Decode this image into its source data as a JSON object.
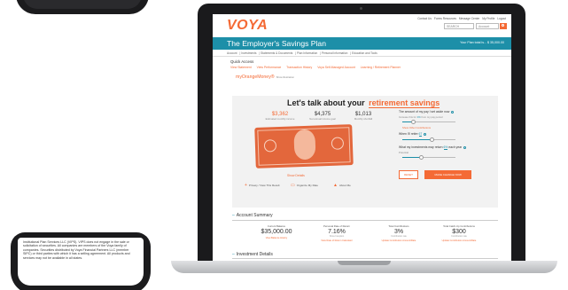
{
  "phone": {
    "text": "Institutional Plan Services LLC (VIPS). VIPS does not engage in the sale or solicitation of securities. All companies are members of the Voya family of companies. Securities distributed by Voya Financial Partners LLC (member SIPC) or third parties with which it has a selling agreement. All products and services may not be available in all states."
  },
  "brand": {
    "logo": "VOYA",
    "accent": "#f46a35",
    "teal": "#1d8fa8"
  },
  "top_links": [
    "Contact Us",
    "Forms Resources",
    "Message Center",
    "My Profile",
    "Logout"
  ],
  "search": {
    "placeholder": "SEARCH",
    "select": "Account"
  },
  "plan": {
    "title": "The Employer's Savings Plan",
    "value": "Your Plan total is... $ 35,000.00"
  },
  "menu": [
    "Account",
    "Investments",
    "Statements & Documents",
    "Plan Information",
    "Personal Information",
    "Education and Tools"
  ],
  "quick_access": {
    "title": "Quick Access",
    "links": [
      "View Statement",
      "View Performance",
      "Transaction History",
      "Voya Self-Managed Account",
      "Learning / Retirement Planner"
    ]
  },
  "mcm": {
    "title": "myOrangeMoney®",
    "note": "Show illustration"
  },
  "talk": {
    "prefix": "Let's talk about your",
    "selection": "retirement savings"
  },
  "stats": [
    {
      "value": "$3,362",
      "label": "Estimated monthly income"
    },
    {
      "value": "$4,375",
      "label": "Net annual income goal"
    },
    {
      "value": "$1,013",
      "label": "Monthly shortfall"
    }
  ],
  "show_details": "Show Details",
  "bottom_icons": [
    {
      "glyph": "+",
      "label": "Privacy / View This Result"
    },
    {
      "glyph": "▭",
      "label": "Organize My Rate"
    },
    {
      "glyph": "▲",
      "label": "About Me"
    }
  ],
  "controls": {
    "contribution": {
      "label": "The amount of my pay I set aside now",
      "sub": "Increase this for",
      "value": "3%",
      "after": "from my pay period",
      "link": "Show Other Contributions",
      "level": 0.2
    },
    "retire": {
      "label": "When I'll retire",
      "value": "67",
      "level": 0.55
    },
    "return": {
      "label": "What my investments may return",
      "value": "6%",
      "after": "each year",
      "sub": "Potential",
      "level": 0.35
    },
    "reset_label": "RESET",
    "save_label": "MAKE CHANGE NOW"
  },
  "account_summary": {
    "title": "Account Summary",
    "cells": [
      {
        "label": "Current Balance",
        "value": "$35,000.00",
        "sub": "",
        "action": "View Balance History"
      },
      {
        "label": "Personal Rate of Return",
        "value": "7.16%",
        "sub": "Since Inception",
        "action": "View Rate of Return Calculator"
      },
      {
        "label": "Total Contributions",
        "value": "3%",
        "sub": "Contribution rate",
        "action": "Update Contribution Amount/Rate"
      },
      {
        "label": "Total Catch-Up Contributions",
        "value": "$300",
        "sub": "Contribution rate",
        "action": "Update Contribution Amount/Rate"
      }
    ]
  },
  "investment_details": {
    "title": "Investment Details"
  }
}
